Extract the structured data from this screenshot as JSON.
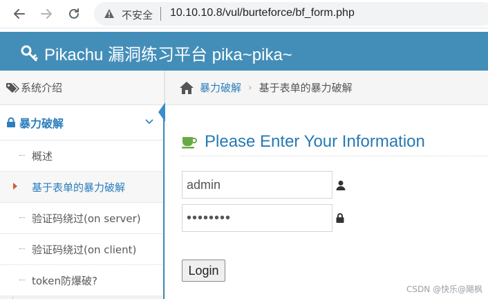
{
  "browser": {
    "insecure_label": "不安全",
    "url": "10.10.10.8/vul/burteforce/bf_form.php"
  },
  "header": {
    "title": "Pikachu 漏洞练习平台 pika~pika~"
  },
  "sidebar": {
    "intro_label": "系统介绍",
    "group_label": "暴力破解",
    "items": [
      {
        "label": "概述"
      },
      {
        "label": "基于表单的暴力破解",
        "active": true
      },
      {
        "label": "验证码绕过(on server)"
      },
      {
        "label": "验证码绕过(on client)"
      },
      {
        "label": "token防爆破?"
      }
    ]
  },
  "breadcrumb": {
    "parent": "暴力破解",
    "current": "基于表单的暴力破解"
  },
  "main": {
    "page_title": "Please Enter Your Information",
    "username_value": "admin",
    "password_mask": "••••••••",
    "login_label": "Login"
  },
  "watermark": "CSDN @快乐@飓枫",
  "colors": {
    "header_bg": "#438eb9",
    "link": "#2b7dbc",
    "title": "#2679b5",
    "cup": "#69aa46"
  }
}
